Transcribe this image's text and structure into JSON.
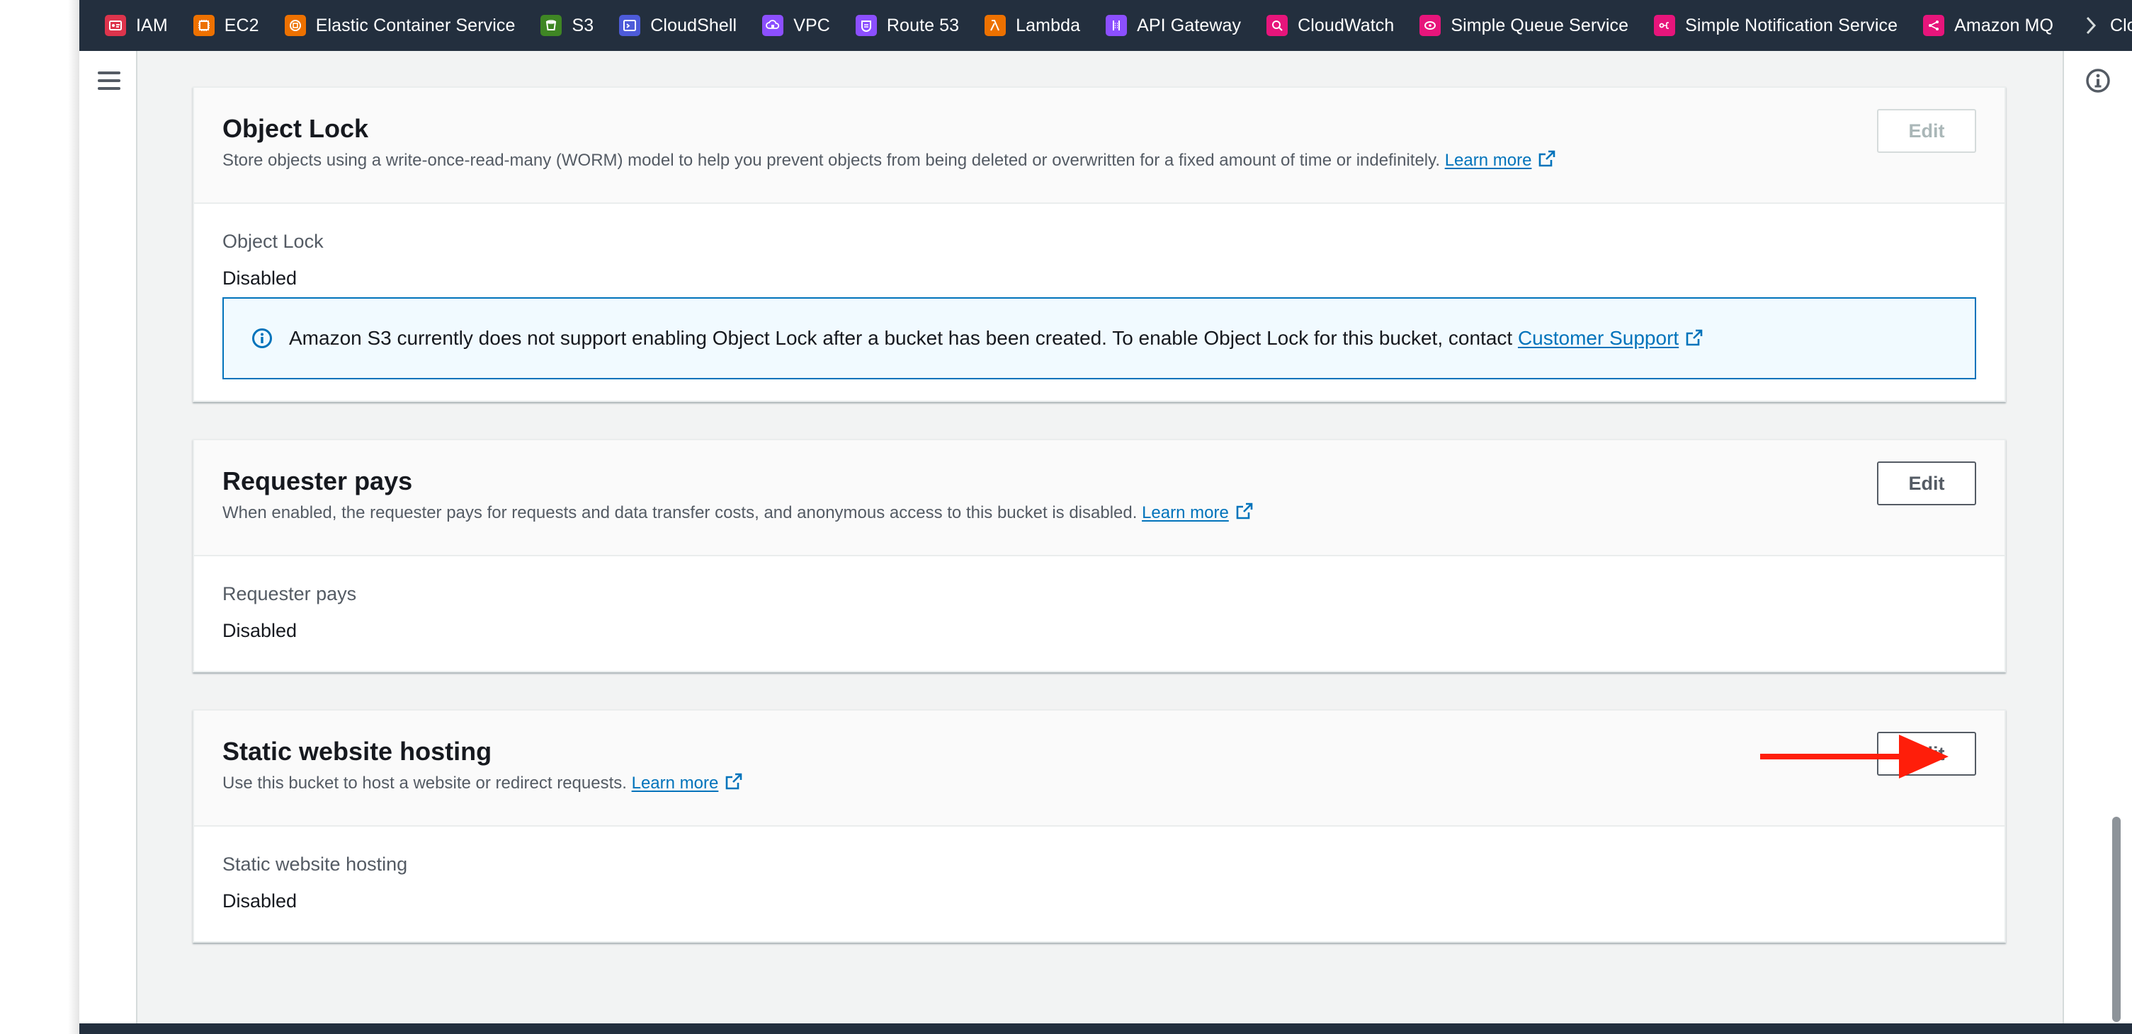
{
  "favorites": [
    {
      "label": "IAM",
      "icon": "iam-icon",
      "color": "#dd344c"
    },
    {
      "label": "EC2",
      "icon": "ec2-icon",
      "color": "#ed7100"
    },
    {
      "label": "Elastic Container Service",
      "icon": "ecs-icon",
      "color": "#ed7100"
    },
    {
      "label": "S3",
      "icon": "s3-icon",
      "color": "#3f8624"
    },
    {
      "label": "CloudShell",
      "icon": "cloudshell-icon",
      "color": "#4d5bd9"
    },
    {
      "label": "VPC",
      "icon": "vpc-icon",
      "color": "#8c4fff"
    },
    {
      "label": "Route 53",
      "icon": "route53-icon",
      "color": "#8c4fff"
    },
    {
      "label": "Lambda",
      "icon": "lambda-icon",
      "color": "#ed7100"
    },
    {
      "label": "API Gateway",
      "icon": "api-gateway-icon",
      "color": "#8c4fff"
    },
    {
      "label": "CloudWatch",
      "icon": "cloudwatch-icon",
      "color": "#e7157b"
    },
    {
      "label": "Simple Queue Service",
      "icon": "sqs-icon",
      "color": "#e7157b"
    },
    {
      "label": "Simple Notification Service",
      "icon": "sns-icon",
      "color": "#e7157b"
    },
    {
      "label": "Amazon MQ",
      "icon": "amazon-mq-icon",
      "color": "#e7157b"
    },
    {
      "label": "Cloud",
      "icon": "cloud-icon",
      "color": "#8c4fff"
    }
  ],
  "sections": {
    "object_lock": {
      "title": "Object Lock",
      "description": "Store objects using a write-once-read-many (WORM) model to help you prevent objects from being deleted or overwritten for a fixed amount of time or indefinitely.",
      "learn_more": "Learn more",
      "edit_label": "Edit",
      "field_label": "Object Lock",
      "field_value": "Disabled",
      "alert_text": "Amazon S3 currently does not support enabling Object Lock after a bucket has been created. To enable Object Lock for this bucket, contact",
      "alert_link": "Customer Support"
    },
    "requester_pays": {
      "title": "Requester pays",
      "description": "When enabled, the requester pays for requests and data transfer costs, and anonymous access to this bucket is disabled.",
      "learn_more": "Learn more",
      "edit_label": "Edit",
      "field_label": "Requester pays",
      "field_value": "Disabled"
    },
    "static_website": {
      "title": "Static website hosting",
      "description": "Use this bucket to host a website or redirect requests.",
      "learn_more": "Learn more",
      "edit_label": "Edit",
      "field_label": "Static website hosting",
      "field_value": "Disabled"
    }
  },
  "colors": {
    "nav_bg": "#232f3e",
    "link": "#0073bb",
    "annotation_arrow": "#ff1e0a"
  }
}
